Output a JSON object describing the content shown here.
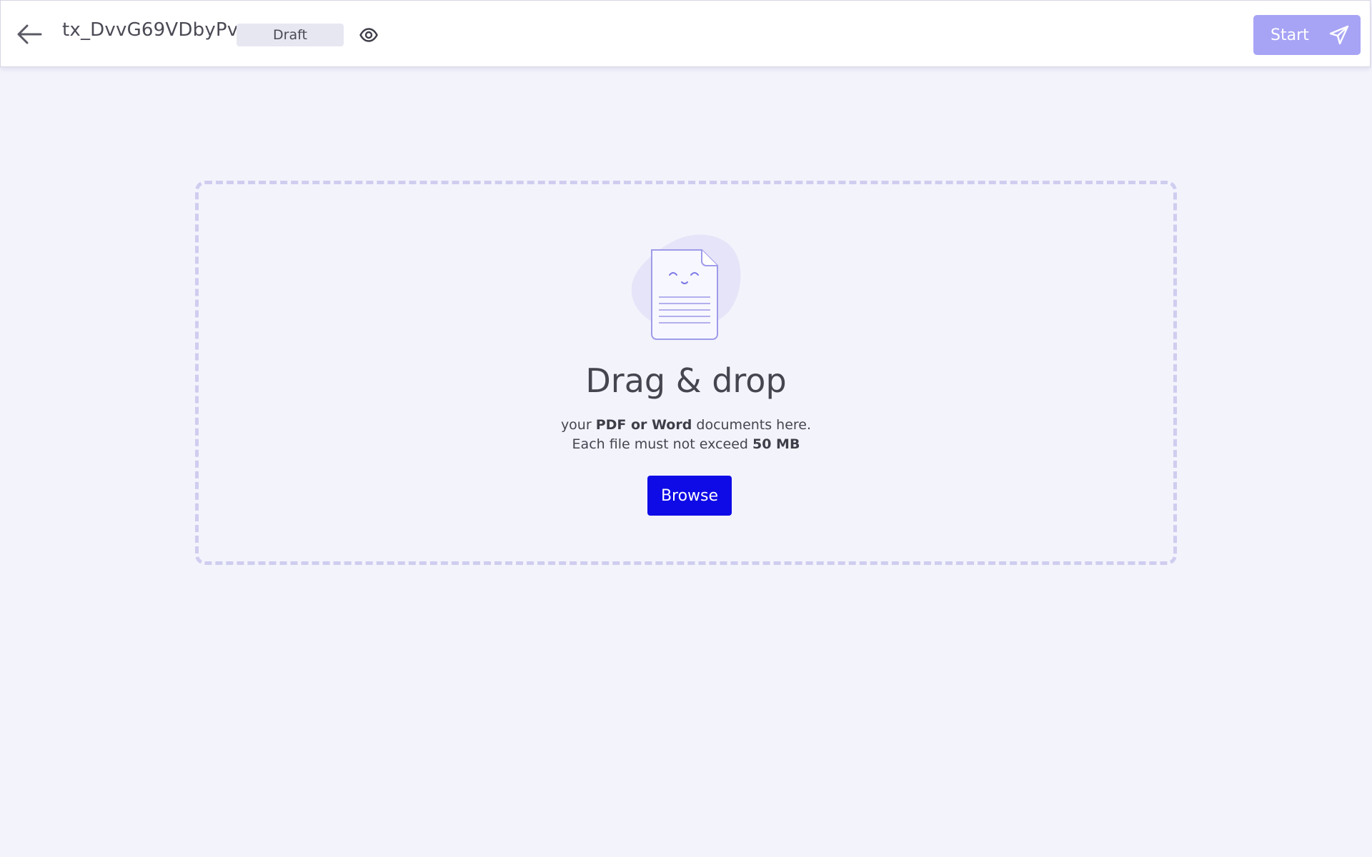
{
  "header": {
    "back_icon": "arrow-left-icon",
    "title": "tx_DvvG69VDbyPv",
    "status_badge": "Draft",
    "preview_icon": "eye-icon",
    "start_label": "Start",
    "start_icon": "paper-plane-icon",
    "start_button_color": "#a7a4f5"
  },
  "dropzone": {
    "illustration_icon": "document-smiley-icon",
    "heading": "Drag & drop",
    "line1_prefix": "your ",
    "line1_bold": "PDF or Word",
    "line1_suffix": " documents here.",
    "line2_prefix": "Each file must not exceed ",
    "line2_bold": "50 MB",
    "browse_label": "Browse",
    "browse_button_color": "#0f0be6",
    "border_color": "#cfcdef"
  },
  "colors": {
    "page_background": "#f3f3fc",
    "accent": "#0f0be6"
  }
}
